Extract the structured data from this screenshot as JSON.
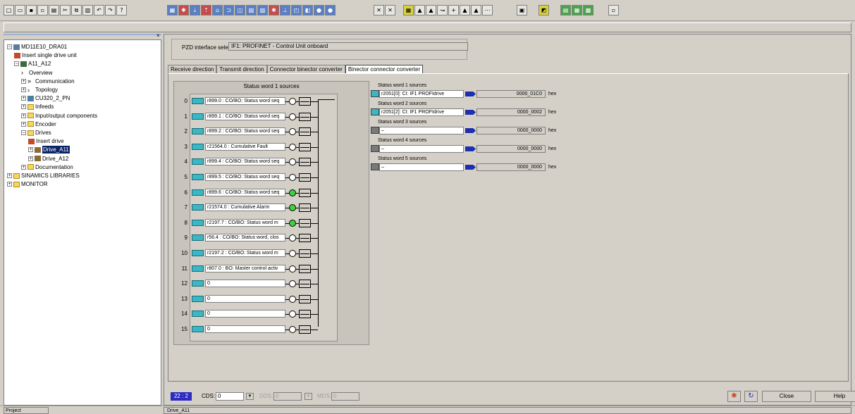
{
  "tree": {
    "items": [
      {
        "label": "MD11E10_DRA01",
        "level": 0,
        "exp": "−",
        "icon": "project-icon"
      },
      {
        "label": "Insert single drive unit",
        "level": 1,
        "exp": "",
        "icon": "insert-icon"
      },
      {
        "label": "A11_A12",
        "level": 1,
        "exp": "−",
        "icon": "device-icon"
      },
      {
        "label": "Overview",
        "level": 2,
        "exp": "",
        "icon": "arrow-icon"
      },
      {
        "label": "Communication",
        "level": 2,
        "exp": "+",
        "icon": "double-arrow-icon"
      },
      {
        "label": "Topology",
        "level": 2,
        "exp": "+",
        "icon": "arrow-icon"
      },
      {
        "label": "CU320_2_PN",
        "level": 2,
        "exp": "+",
        "icon": "control-unit-icon"
      },
      {
        "label": "Infeeds",
        "level": 2,
        "exp": "+",
        "icon": "folder-icon"
      },
      {
        "label": "Input/output components",
        "level": 2,
        "exp": "+",
        "icon": "folder-icon"
      },
      {
        "label": "Encoder",
        "level": 2,
        "exp": "+",
        "icon": "folder-icon"
      },
      {
        "label": "Drives",
        "level": 2,
        "exp": "−",
        "icon": "folder-icon"
      },
      {
        "label": "Insert drive",
        "level": 3,
        "exp": "",
        "icon": "insert-icon"
      },
      {
        "label": "Drive_A11",
        "level": 3,
        "exp": "+",
        "icon": "drive-icon",
        "selected": true
      },
      {
        "label": "Drive_A12",
        "level": 3,
        "exp": "+",
        "icon": "drive-icon"
      },
      {
        "label": "Documentation",
        "level": 2,
        "exp": "+",
        "icon": "folder-icon"
      },
      {
        "label": "SINAMICS LIBRARIES",
        "level": 0,
        "exp": "+",
        "icon": "folder-icon"
      },
      {
        "label": "MONITOR",
        "level": 0,
        "exp": "+",
        "icon": "folder-icon"
      }
    ]
  },
  "pzd": {
    "label": "PZD interface selection:",
    "value": "IF1: PROFINET - Control Unit onboard"
  },
  "tabs": [
    {
      "label": "Receive direction",
      "active": false
    },
    {
      "label": "Transmit direction",
      "active": false
    },
    {
      "label": "Connector binector converter",
      "active": false
    },
    {
      "label": "Binector connector converter",
      "active": true
    }
  ],
  "status_word_panel": {
    "title": "Status word 1 sources",
    "rows": [
      {
        "num": "0",
        "text": "r899.0 : CO/BO: Status word seq",
        "on": false
      },
      {
        "num": "1",
        "text": "r899.1 : CO/BO: Status word seq",
        "on": false
      },
      {
        "num": "2",
        "text": "r899.2 : CO/BO: Status word seq",
        "on": false
      },
      {
        "num": "3",
        "text": "r21564.0 : Cumulative Fault",
        "on": false
      },
      {
        "num": "4",
        "text": "r899.4 : CO/BO: Status word seq",
        "on": false
      },
      {
        "num": "5",
        "text": "r899.5 : CO/BO: Status word seq",
        "on": false
      },
      {
        "num": "6",
        "text": "r899.6 : CO/BO: Status word seq",
        "on": true
      },
      {
        "num": "7",
        "text": "r21574.0 : Cumulative Alarm",
        "on": true
      },
      {
        "num": "8",
        "text": "r2197.7 : CO/BO: Status word m",
        "on": true
      },
      {
        "num": "9",
        "text": "r56.4 : CO/BO: Status word, clos",
        "on": false
      },
      {
        "num": "10",
        "text": "r2197.2 : CO/BO: Status word m",
        "on": false
      },
      {
        "num": "11",
        "text": "r807.0 : BO: Master control activ",
        "on": false
      },
      {
        "num": "12",
        "text": "0",
        "on": false
      },
      {
        "num": "13",
        "text": "0",
        "on": false
      },
      {
        "num": "14",
        "text": "0",
        "on": false
      },
      {
        "num": "15",
        "text": "0",
        "on": false
      }
    ]
  },
  "sources": [
    {
      "title": "Status word 1 sources",
      "field": "r2051[0]: CI: IF1 PROFIdrive",
      "value": "0000_01C0",
      "unit": "hex",
      "active": true
    },
    {
      "title": "Status word 2 sources",
      "field": "r2051[2]: CI: IF1 PROFIdrive",
      "value": "0000_0002",
      "unit": "hex",
      "active": true
    },
    {
      "title": "Status word 3 sources",
      "field": "–",
      "value": "0000_0000",
      "unit": "hex",
      "active": false
    },
    {
      "title": "Status word 4 sources",
      "field": "–",
      "value": "0000_0000",
      "unit": "hex",
      "active": false
    },
    {
      "title": "Status word 5 sources",
      "field": "–",
      "value": "0000_0000",
      "unit": "hex",
      "active": false
    }
  ],
  "bottom": {
    "counter": "22 : 2",
    "cds_label": "CDS:",
    "cds_value": "0",
    "dds_label": "DDS:",
    "dds_value": "0",
    "mds_label": "MDS:",
    "mds_value": "0",
    "close_label": "Close",
    "help_label": "Help"
  },
  "statusbar": {
    "project": "Project",
    "drive": "Drive_A11"
  },
  "colors": {
    "led_on": "#3fd23f",
    "connector": "#3bb7c4",
    "arrow": "#1b2fb0",
    "counter": "#2b2bc2"
  }
}
